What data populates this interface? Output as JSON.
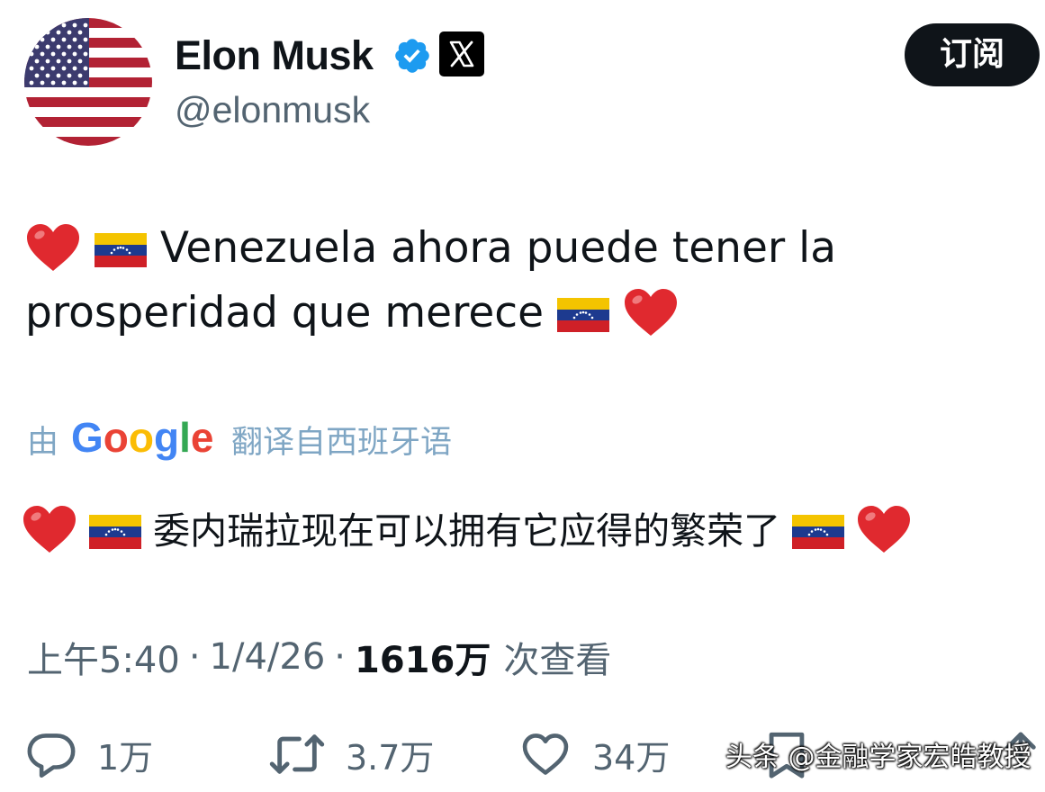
{
  "header": {
    "display_name": "Elon Musk",
    "handle": "@elonmusk",
    "subscribe_label": "订阅",
    "avatar_icon": "us-flag-avatar",
    "verified_icon": "verified-badge-icon",
    "affiliation_icon": "x-logo-icon"
  },
  "tweet": {
    "text_line_1": "Venezuela ahora puede tener la",
    "text_line_2": "prosperidad que merece",
    "translation_prefix": "由",
    "translation_provider": "Google",
    "translation_suffix": "翻译自西班牙语",
    "translated_text": "委内瑞拉现在可以拥有它应得的繁荣了"
  },
  "meta": {
    "time": "上午5:40",
    "date": "1/4/26",
    "separator": "·",
    "views_value": "1616万",
    "views_label": "次查看"
  },
  "actions": {
    "replies": "1万",
    "reposts": "3.7万",
    "likes": "34万"
  },
  "watermark": "头条 @金融学家宏皓教授",
  "colors": {
    "text_primary": "#0f1419",
    "text_secondary": "#536471",
    "translate_link": "#7fa6c4",
    "verified_blue": "#1d9bf0",
    "heart_red": "#e0292f"
  }
}
